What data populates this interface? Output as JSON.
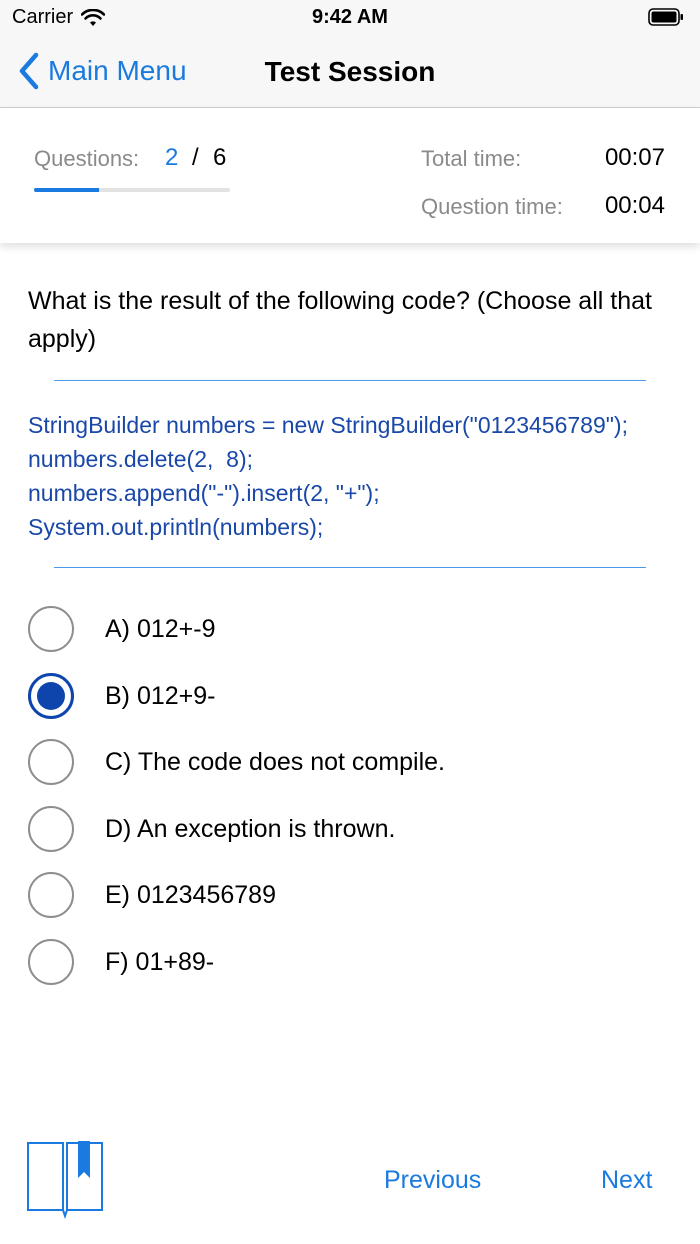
{
  "status_bar": {
    "carrier": "Carrier",
    "time": "9:42 AM"
  },
  "nav": {
    "back_label": "Main Menu",
    "title": "Test Session"
  },
  "progress": {
    "questions_label": "Questions:",
    "current": "2",
    "separator": "/",
    "total": "6",
    "progress_fraction": 0.333,
    "total_time_label": "Total time:",
    "total_time": "00:07",
    "question_time_label": "Question time:",
    "question_time": "00:04"
  },
  "question": {
    "text": "What is the result of the following code? (Choose all that apply)",
    "code": "StringBuilder numbers = new StringBuilder(\"0123456789\");\nnumbers.delete(2,  8);\nnumbers.append(\"-\").insert(2, \"+\");\nSystem.out.println(numbers);"
  },
  "options": [
    {
      "label": "A) 012+-9",
      "selected": false
    },
    {
      "label": "B) 012+9-",
      "selected": true
    },
    {
      "label": "C) The code does not compile.",
      "selected": false
    },
    {
      "label": "D) An exception is thrown.",
      "selected": false
    },
    {
      "label": "E) 0123456789",
      "selected": false
    },
    {
      "label": "F) 01+89-",
      "selected": false
    }
  ],
  "bottom_bar": {
    "bookmark_icon": "book-bookmark-icon",
    "previous_label": "Previous",
    "next_label": "Next"
  },
  "colors": {
    "accent": "#1a7ae0",
    "code": "#1a48a8",
    "selected_radio": "#0d45ad"
  }
}
